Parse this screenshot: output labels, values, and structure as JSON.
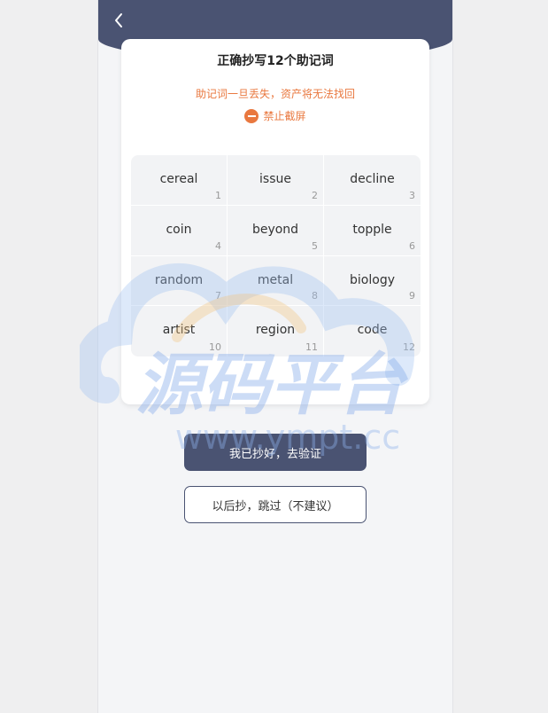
{
  "header": {
    "back_icon": "chevron-left-icon"
  },
  "card": {
    "title": "正确抄写12个助记词",
    "warning": "助记词一旦丢失，资产将无法找回",
    "screenshot_notice": "禁止截屏",
    "screenshot_icon": "no-entry-icon"
  },
  "words": [
    {
      "word": "cereal",
      "index": "1"
    },
    {
      "word": "issue",
      "index": "2"
    },
    {
      "word": "decline",
      "index": "3"
    },
    {
      "word": "coin",
      "index": "4"
    },
    {
      "word": "beyond",
      "index": "5"
    },
    {
      "word": "topple",
      "index": "6"
    },
    {
      "word": "random",
      "index": "7"
    },
    {
      "word": "metal",
      "index": "8"
    },
    {
      "word": "biology",
      "index": "9"
    },
    {
      "word": "artist",
      "index": "10"
    },
    {
      "word": "region",
      "index": "11"
    },
    {
      "word": "code",
      "index": "12"
    }
  ],
  "actions": {
    "confirm_label": "我已抄好，去验证",
    "skip_label": "以后抄，跳过（不建议）"
  },
  "watermark": {
    "text": "源码平台",
    "url": "www.ympt.cc"
  },
  "colors": {
    "primary": "#4a5372",
    "warning": "#e9783f"
  }
}
